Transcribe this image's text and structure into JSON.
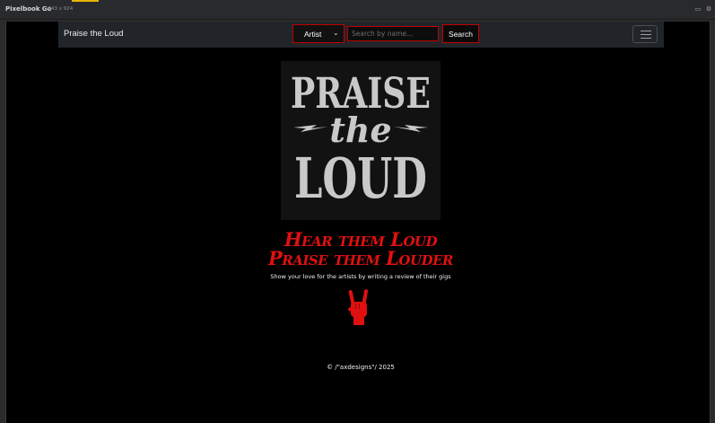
{
  "devtool": {
    "app_name": "Pixelbook Go",
    "dimensions": "1643 x 924"
  },
  "navbar": {
    "brand": "Praise the Loud",
    "filter_select": {
      "selected": "Artist"
    },
    "search": {
      "placeholder": "Search by name...",
      "value": ""
    },
    "search_button": "Search"
  },
  "logo": {
    "line1": "PRAISE",
    "line2": "the",
    "line3": "LOUD"
  },
  "hero": {
    "headline_line1": "Hear them Loud",
    "headline_line2": "Praise them Louder",
    "tagline": "Show your love for the artists by writing a review of their gigs"
  },
  "footer": {
    "copyright": "© /\"axdesigns\"/ 2025"
  },
  "colors": {
    "accent_red": "#e01010",
    "navbar_bg": "#212529",
    "page_bg": "#000000",
    "logo_text": "#c9c9c9"
  },
  "icons": {
    "menu": "hamburger-icon",
    "dropdown": "chevron-down-icon",
    "hero": "rock-on-hand-icon"
  }
}
